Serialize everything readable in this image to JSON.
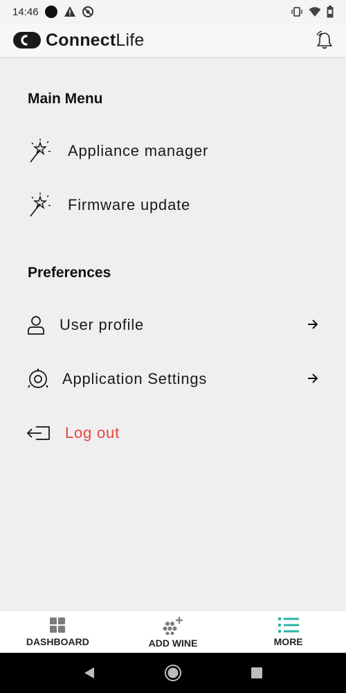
{
  "status_bar": {
    "time": "14:46"
  },
  "header": {
    "logo_bold": "Connect",
    "logo_light": "Life"
  },
  "main_menu": {
    "title": "Main Menu",
    "items": [
      {
        "label": "Appliance manager",
        "icon": "magic-wand-icon"
      },
      {
        "label": "Firmware update",
        "icon": "magic-wand-icon"
      }
    ]
  },
  "preferences": {
    "title": "Preferences",
    "items": [
      {
        "label": "User profile",
        "icon": "user-icon"
      },
      {
        "label": "Application Settings",
        "icon": "settings-icon"
      }
    ]
  },
  "logout": {
    "label": "Log out",
    "color": "#e8453c"
  },
  "bottom_nav": {
    "tabs": [
      {
        "label": "DASHBOARD",
        "icon": "dashboard-grid-icon"
      },
      {
        "label": "ADD WINE",
        "icon": "add-wine-icon"
      },
      {
        "label": "MORE",
        "icon": "list-icon",
        "active": true
      }
    ],
    "accent": "#2bb3a3"
  }
}
